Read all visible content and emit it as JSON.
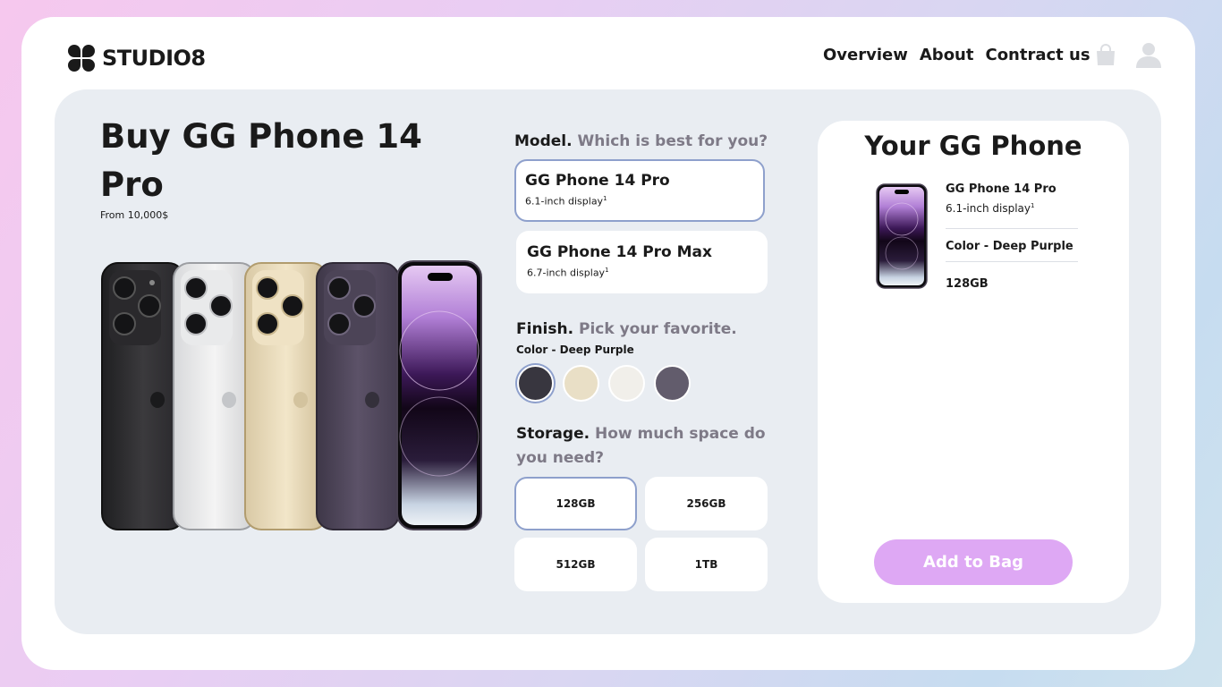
{
  "brand": {
    "name": "STUDIO8"
  },
  "nav": {
    "items": [
      "Overview",
      "About",
      "Contract us"
    ]
  },
  "icons": {
    "bag": "shopping-bag-icon",
    "user": "user-icon",
    "logo": "studio8-logo-icon"
  },
  "product": {
    "title": "Buy GG Phone 14 Pro",
    "price": "From 10,000$"
  },
  "model": {
    "heading": "Model.",
    "heading_muted": "Which is best for you?",
    "options": [
      {
        "name": "GG Phone 14 Pro",
        "display": "6.1-inch display",
        "note": "1",
        "selected": true
      },
      {
        "name": "GG Phone 14 Pro Max",
        "display": "6.7-inch display",
        "note": "1",
        "selected": false
      }
    ]
  },
  "finish": {
    "heading": "Finish.",
    "heading_muted": "Pick your favorite.",
    "color_label": "Color - Deep Purple",
    "swatches": [
      {
        "color": "#38363f",
        "selected": true
      },
      {
        "color": "#e9dfc6",
        "selected": false
      },
      {
        "color": "#f1efea",
        "selected": false
      },
      {
        "color": "#625c6c",
        "selected": false
      }
    ]
  },
  "storage": {
    "heading": "Storage.",
    "heading_muted": "How much space do you need?",
    "options": [
      "128GB",
      "256GB",
      "512GB",
      "1TB"
    ],
    "selected": "128GB"
  },
  "summary": {
    "title": "Your GG Phone",
    "model": "GG Phone 14 Pro",
    "display": "6.1-inch display",
    "note": "1",
    "color": "Color - Deep Purple",
    "storage": "128GB",
    "cta": "Add to Bag"
  },
  "colors": {
    "accent": "#dea8f4",
    "selected_border": "#8ea0cc",
    "panel": "#e9edf2",
    "muted_text": "#7e7a87"
  }
}
